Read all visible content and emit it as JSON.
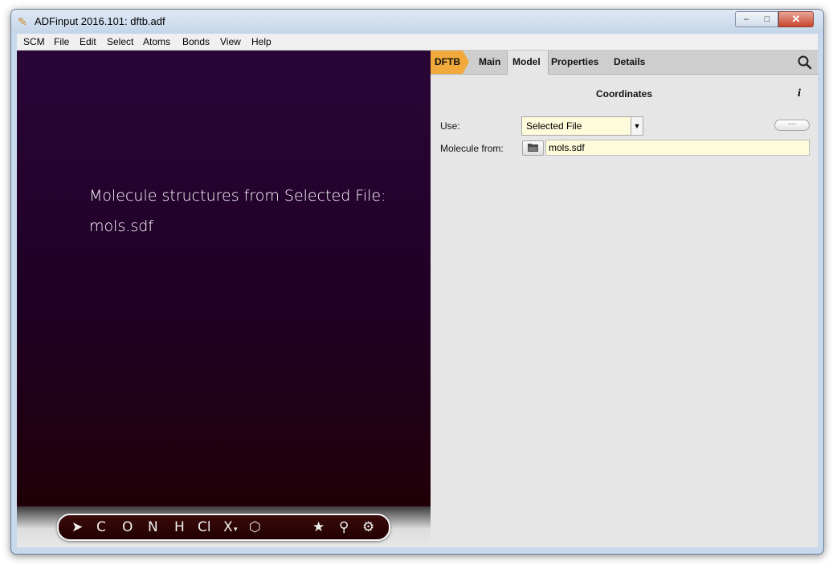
{
  "window": {
    "title": "ADFinput 2016.101: dftb.adf",
    "controls": {
      "minimize": "–",
      "maximize": "□",
      "close": "✕"
    }
  },
  "menu": [
    "SCM",
    "File",
    "Edit",
    "Select",
    "Atoms",
    "Bonds",
    "View",
    "Help"
  ],
  "viewer": {
    "line1": "Molecule structures from Selected File:",
    "line2": "mols.sdf"
  },
  "toolbar": {
    "tools": [
      {
        "name": "select-tool",
        "label": "➤"
      },
      {
        "name": "carbon-tool",
        "label": "C"
      },
      {
        "name": "oxygen-tool",
        "label": "O"
      },
      {
        "name": "nitrogen-tool",
        "label": "N"
      },
      {
        "name": "hydrogen-tool",
        "label": "H"
      },
      {
        "name": "chlorine-tool",
        "label": "Cl"
      },
      {
        "name": "element-picker-tool",
        "label": "X"
      },
      {
        "name": "ring-tool",
        "label": "⬡"
      },
      {
        "name": "favorites-tool",
        "label": "★"
      },
      {
        "name": "wand-tool",
        "label": "⚲"
      },
      {
        "name": "settings-tool",
        "label": "⚙"
      }
    ]
  },
  "panel": {
    "tabs": [
      "DFTB",
      "Main",
      "Model",
      "Properties",
      "Details"
    ],
    "active_tab": "Model",
    "accent_color": "#f0a93a",
    "heading": "Coordinates",
    "info": "i",
    "use_label": "Use:",
    "use_value": "Selected File",
    "more_button": "···",
    "molecule_label": "Molecule from:",
    "molecule_file": "mols.sdf"
  }
}
